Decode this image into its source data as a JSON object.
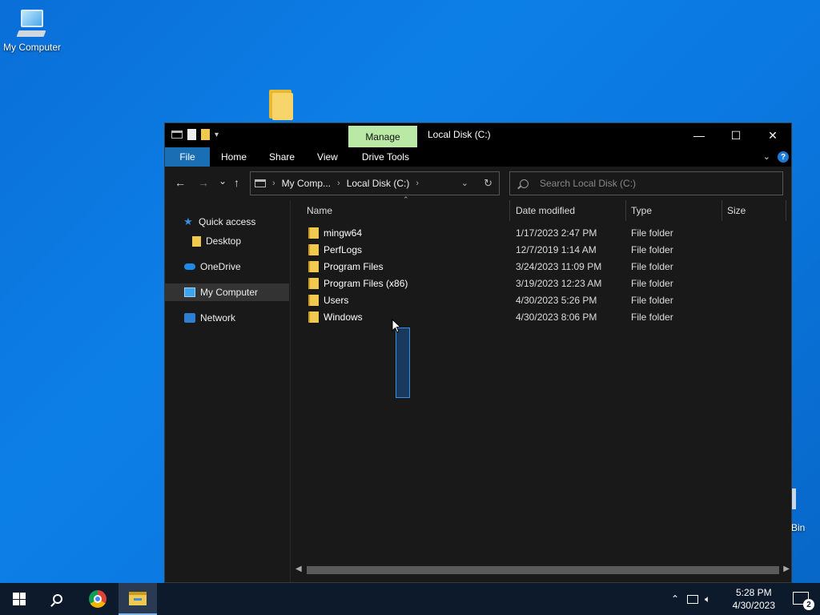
{
  "desktop": {
    "icons": [
      {
        "label": "My Computer"
      },
      {
        "label": "Bin"
      }
    ]
  },
  "window": {
    "title": "Local Disk (C:)",
    "manage_tab": "Manage",
    "controls": {
      "minimize": "—",
      "maximize": "☐",
      "close": "✕"
    },
    "ribbon": {
      "tabs": [
        "File",
        "Home",
        "Share",
        "View",
        "Drive Tools"
      ]
    },
    "nav": {
      "back": "←",
      "forward": "→",
      "recent": "⌄",
      "up": "↑"
    },
    "address": {
      "crumbs": [
        "My Comp...",
        "Local Disk (C:)"
      ]
    },
    "search": {
      "placeholder": "Search Local Disk (C:)"
    },
    "sidebar": {
      "items": [
        {
          "label": "Quick access",
          "icon": "star-icon"
        },
        {
          "label": "Desktop",
          "icon": "folder-icon"
        },
        {
          "label": "OneDrive",
          "icon": "cloud-icon"
        },
        {
          "label": "My Computer",
          "icon": "monitor-icon",
          "selected": true
        },
        {
          "label": "Network",
          "icon": "network-icon"
        }
      ]
    },
    "columns": [
      "Name",
      "Date modified",
      "Type",
      "Size"
    ],
    "rows": [
      {
        "name": "mingw64",
        "date": "1/17/2023 2:47 PM",
        "type": "File folder"
      },
      {
        "name": "PerfLogs",
        "date": "12/7/2019 1:14 AM",
        "type": "File folder"
      },
      {
        "name": "Program Files",
        "date": "3/24/2023 11:09 PM",
        "type": "File folder"
      },
      {
        "name": "Program Files (x86)",
        "date": "3/19/2023 12:23 AM",
        "type": "File folder"
      },
      {
        "name": "Users",
        "date": "4/30/2023 5:26 PM",
        "type": "File folder"
      },
      {
        "name": "Windows",
        "date": "4/30/2023 8:06 PM",
        "type": "File folder"
      }
    ]
  },
  "taskbar": {
    "time": "5:28 PM",
    "date": "4/30/2023",
    "notifications": "2"
  }
}
